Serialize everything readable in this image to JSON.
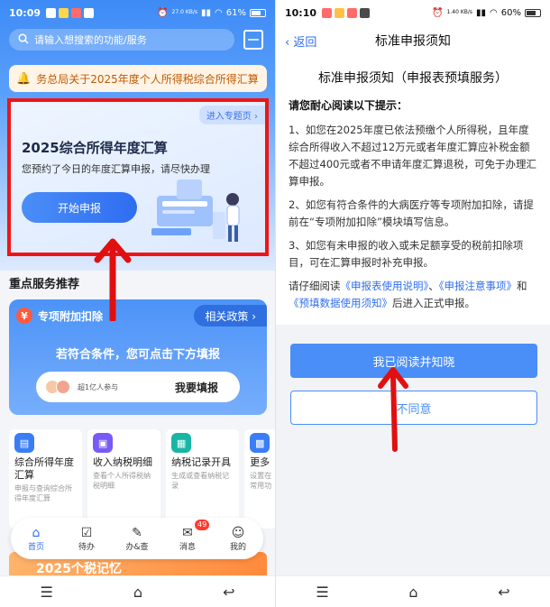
{
  "colors": {
    "primary": "#2f6df0",
    "highlight_box": "#f01414",
    "arrow": "#e01010",
    "badge_red": "#ff3b30"
  },
  "left": {
    "status": {
      "time": "10:09",
      "network": "27.0 KB/s",
      "battery": "61%"
    },
    "search": {
      "placeholder": "请输入想搜索的功能/服务",
      "search_icon": "search-icon",
      "scan_icon": "scan-icon"
    },
    "notice": {
      "text": "务总局关于2025年度个人所得税综合所得汇算"
    },
    "promo": {
      "topic_link": "进入专题页 ›",
      "title": "2025综合所得年度汇算",
      "subtitle": "您预约了今日的年度汇算申报，请尽快办理",
      "button": "开始申报"
    },
    "section_title": "重点服务推荐",
    "deduction": {
      "badge": "专项附加扣除",
      "policy": "相关政策 ›",
      "hint": "若符合条件，您可点击下方填报",
      "users": "超1亿人参与",
      "fill_button": "我要填报"
    },
    "services": [
      {
        "name": "综合所得年度汇算",
        "desc": "申报与查询综合所得年度汇算",
        "color": "#3a7ef5"
      },
      {
        "name": "收入纳税明细",
        "desc": "查看个人所得税纳税明细",
        "color": "#7a5af5"
      },
      {
        "name": "纳税记录开具",
        "desc": "生成或查看纳税记录",
        "color": "#19b5a5"
      },
      {
        "name": "更多",
        "desc": "设置在常用功",
        "color": "#3a7ef5"
      }
    ],
    "tabs": [
      {
        "label": "首页",
        "icon": "home-icon"
      },
      {
        "label": "待办",
        "icon": "todo-icon"
      },
      {
        "label": "办&查",
        "icon": "search-doc-icon"
      },
      {
        "label": "消息",
        "icon": "message-icon",
        "badge": "49"
      },
      {
        "label": "我的",
        "icon": "profile-icon"
      }
    ],
    "banner": "2025个税记忆"
  },
  "right": {
    "status": {
      "time": "10:10",
      "network": "1.40 KB/s",
      "battery": "60%"
    },
    "header": {
      "back": "返回",
      "title": "标准申报须知"
    },
    "doc_title": "标准申报须知（申报表预填服务）",
    "lead": "请您耐心阅读以下提示：",
    "p1": "1、如您在2025年度已依法预缴个人所得税，且年度综合所得收入不超过12万元或者年度汇算应补税金额不超过400元或者不申请年度汇算退税，可免于办理汇算申报。",
    "p2": "2、如您有符合条件的大病医疗等专项附加扣除，请提前在“专项附加扣除”模块填写信息。",
    "p3": "3、如您有未申报的收入或未足额享受的税前扣除项目，可在汇算申报时补充申报。",
    "p4": {
      "pre": "请仔细阅读",
      "link1": "《申报表使用说明》",
      "sep1": "、",
      "link2": "《申报注意事项》",
      "sep2": "和",
      "link3": "《预填数据使用须知》",
      "post": "后进入正式申报。"
    },
    "agree_button": "我已阅读并知晓",
    "disagree_button": "不同意"
  }
}
